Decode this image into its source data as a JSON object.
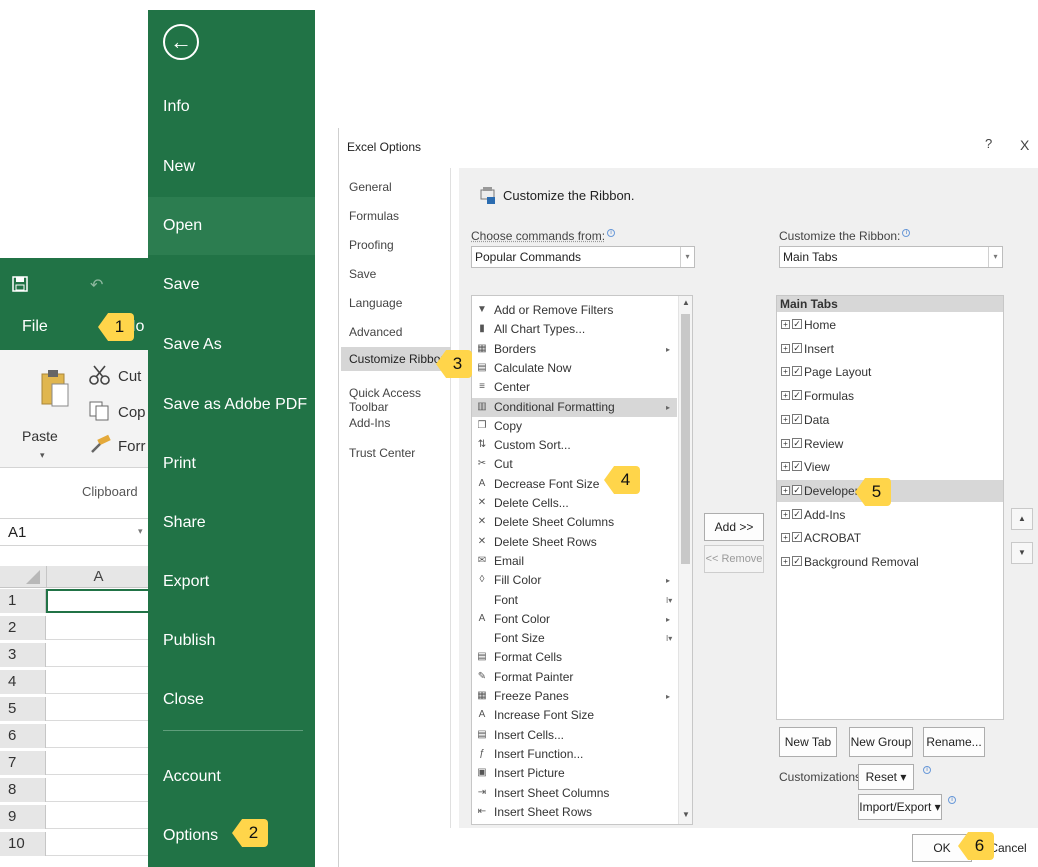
{
  "excel": {
    "tab_file": "File",
    "tab_home": "Ho",
    "paste_label": "Paste",
    "cut_label": "Cut",
    "copy_label": "Cop",
    "format_label": "Forr",
    "clipboard_label": "Clipboard",
    "namebox": "A1",
    "column_header": "A",
    "rows": [
      "1",
      "2",
      "3",
      "4",
      "5",
      "6",
      "7",
      "8",
      "9",
      "10"
    ]
  },
  "backstage": {
    "items": [
      "Info",
      "New",
      "Open",
      "Save",
      "Save As",
      "Save as Adobe PDF",
      "Print",
      "Share",
      "Export",
      "Publish",
      "Close",
      "Account",
      "Options"
    ],
    "active": "Open"
  },
  "badges": [
    "1",
    "2",
    "3",
    "4",
    "5",
    "6"
  ],
  "dialog": {
    "title": "Excel Options",
    "help": "?",
    "close": "X",
    "nav": [
      "General",
      "Formulas",
      "Proofing",
      "Save",
      "Language",
      "Advanced",
      "Customize Ribbon",
      "Quick Access Toolbar",
      "Add-Ins",
      "Trust Center"
    ],
    "nav_active": "Customize Ribbon",
    "header": "Customize the Ribbon.",
    "choose_label": "Choose commands from:",
    "choose_value": "Popular Commands",
    "customize_label": "Customize the Ribbon:",
    "customize_value": "Main Tabs",
    "commands": [
      {
        "label": "Add or Remove Filters",
        "icon": "filter-icon",
        "sub": ""
      },
      {
        "label": "All Chart Types...",
        "icon": "chart-icon",
        "sub": ""
      },
      {
        "label": "Borders",
        "icon": "borders-icon",
        "sub": "▸"
      },
      {
        "label": "Calculate Now",
        "icon": "calculator-icon",
        "sub": ""
      },
      {
        "label": "Center",
        "icon": "center-icon",
        "sub": ""
      },
      {
        "label": "Conditional Formatting",
        "icon": "conditional-formatting-icon",
        "sub": "▸"
      },
      {
        "label": "Copy",
        "icon": "copy-icon",
        "sub": ""
      },
      {
        "label": "Custom Sort...",
        "icon": "sort-icon",
        "sub": ""
      },
      {
        "label": "Cut",
        "icon": "scissors-icon",
        "sub": ""
      },
      {
        "label": "Decrease Font Size",
        "icon": "decrease-font-icon",
        "sub": ""
      },
      {
        "label": "Delete Cells...",
        "icon": "delete-cells-icon",
        "sub": ""
      },
      {
        "label": "Delete Sheet Columns",
        "icon": "delete-columns-icon",
        "sub": ""
      },
      {
        "label": "Delete Sheet Rows",
        "icon": "delete-rows-icon",
        "sub": ""
      },
      {
        "label": "Email",
        "icon": "email-icon",
        "sub": ""
      },
      {
        "label": "Fill Color",
        "icon": "fill-color-icon",
        "sub": "▸"
      },
      {
        "label": "Font",
        "icon": "",
        "sub": "I▾"
      },
      {
        "label": "Font Color",
        "icon": "font-color-icon",
        "sub": "▸"
      },
      {
        "label": "Font Size",
        "icon": "",
        "sub": "I▾"
      },
      {
        "label": "Format Cells",
        "icon": "format-cells-icon",
        "sub": ""
      },
      {
        "label": "Format Painter",
        "icon": "format-painter-icon",
        "sub": ""
      },
      {
        "label": "Freeze Panes",
        "icon": "freeze-panes-icon",
        "sub": "▸"
      },
      {
        "label": "Increase Font Size",
        "icon": "increase-font-icon",
        "sub": ""
      },
      {
        "label": "Insert Cells...",
        "icon": "insert-cells-icon",
        "sub": ""
      },
      {
        "label": "Insert Function...",
        "icon": "function-icon",
        "sub": ""
      },
      {
        "label": "Insert Picture",
        "icon": "picture-icon",
        "sub": ""
      },
      {
        "label": "Insert Sheet Columns",
        "icon": "insert-columns-icon",
        "sub": ""
      },
      {
        "label": "Insert Sheet Rows",
        "icon": "insert-rows-icon",
        "sub": ""
      }
    ],
    "highlighted_command": "Conditional Formatting",
    "add_button": "Add >>",
    "remove_button": "<< Remove",
    "tree_header": "Main Tabs",
    "tabs": [
      "Home",
      "Insert",
      "Page Layout",
      "Formulas",
      "Data",
      "Review",
      "View",
      "Developer",
      "Add-Ins",
      "ACROBAT",
      "Background Removal"
    ],
    "highlighted_tab": "Developer",
    "new_tab": "New Tab",
    "new_group": "New Group",
    "rename": "Rename...",
    "customizations_label": "Customizations:",
    "reset": "Reset ▾",
    "import_export": "Import/Export ▾",
    "ok": "OK",
    "cancel": "Cancel"
  },
  "colors": {
    "excel_green": "#217346",
    "badge_yellow": "#ffd54a"
  }
}
